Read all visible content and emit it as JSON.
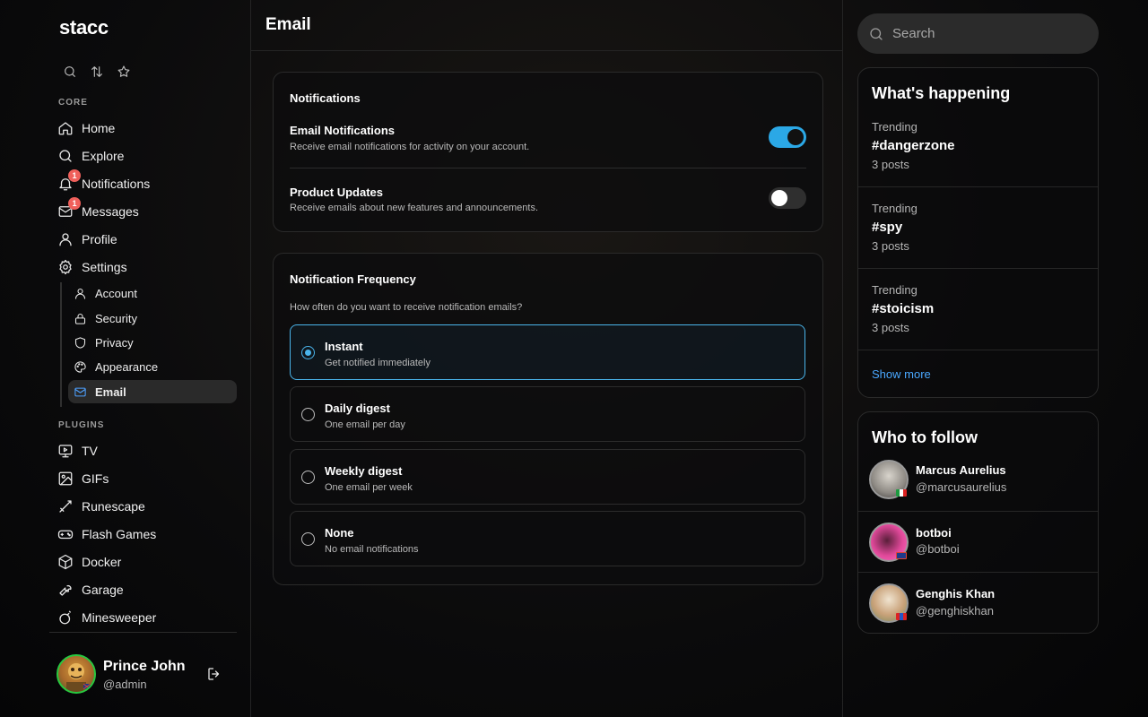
{
  "app": {
    "logo": "stacc"
  },
  "sidebar": {
    "core_label": "CORE",
    "plugins_label": "PLUGINS",
    "core_items": [
      {
        "label": "Home",
        "icon": "home-icon"
      },
      {
        "label": "Explore",
        "icon": "search-icon"
      },
      {
        "label": "Notifications",
        "icon": "bell-icon",
        "badge": "1"
      },
      {
        "label": "Messages",
        "icon": "mail-icon",
        "badge": "1"
      },
      {
        "label": "Profile",
        "icon": "user-icon"
      },
      {
        "label": "Settings",
        "icon": "gear-icon"
      }
    ],
    "settings_items": [
      {
        "label": "Account",
        "icon": "user-icon"
      },
      {
        "label": "Security",
        "icon": "lock-icon"
      },
      {
        "label": "Privacy",
        "icon": "shield-icon"
      },
      {
        "label": "Appearance",
        "icon": "palette-icon"
      },
      {
        "label": "Email",
        "icon": "mail-icon",
        "active": true
      }
    ],
    "plugin_items": [
      {
        "label": "TV",
        "icon": "tv-icon"
      },
      {
        "label": "GIFs",
        "icon": "image-icon"
      },
      {
        "label": "Runescape",
        "icon": "sword-icon"
      },
      {
        "label": "Flash Games",
        "icon": "gamepad-icon"
      },
      {
        "label": "Docker",
        "icon": "box-icon"
      },
      {
        "label": "Garage",
        "icon": "wrench-icon"
      },
      {
        "label": "Minesweeper",
        "icon": "bomb-icon"
      }
    ],
    "user": {
      "name": "Prince John",
      "handle": "@admin"
    }
  },
  "main": {
    "title": "Email",
    "notifications_card": {
      "title": "Notifications",
      "settings": [
        {
          "title": "Email Notifications",
          "description": "Receive email notifications for activity on your account.",
          "enabled": true
        },
        {
          "title": "Product Updates",
          "description": "Receive emails about new features and announcements.",
          "enabled": false
        }
      ]
    },
    "frequency_card": {
      "title": "Notification Frequency",
      "question": "How often do you want to receive notification emails?",
      "options": [
        {
          "label": "Instant",
          "description": "Get notified immediately",
          "selected": true
        },
        {
          "label": "Daily digest",
          "description": "One email per day",
          "selected": false
        },
        {
          "label": "Weekly digest",
          "description": "One email per week",
          "selected": false
        },
        {
          "label": "None",
          "description": "No email notifications",
          "selected": false
        }
      ]
    }
  },
  "right": {
    "search_placeholder": "Search",
    "whats_happening": {
      "title": "What's happening",
      "trends": [
        {
          "category": "Trending",
          "tag": "#dangerzone",
          "count": "3 posts"
        },
        {
          "category": "Trending",
          "tag": "#spy",
          "count": "3 posts"
        },
        {
          "category": "Trending",
          "tag": "#stoicism",
          "count": "3 posts"
        }
      ],
      "show_more": "Show more"
    },
    "who_to_follow": {
      "title": "Who to follow",
      "accounts": [
        {
          "name": "Marcus Aurelius",
          "handle": "@marcusaurelius"
        },
        {
          "name": "botboi",
          "handle": "@botboi"
        },
        {
          "name": "Genghis Khan",
          "handle": "@genghiskhan"
        }
      ]
    }
  },
  "colors": {
    "accent": "#2ba8e6",
    "link": "#4aa8ff",
    "badge": "#f0605b",
    "online": "#28c840"
  }
}
